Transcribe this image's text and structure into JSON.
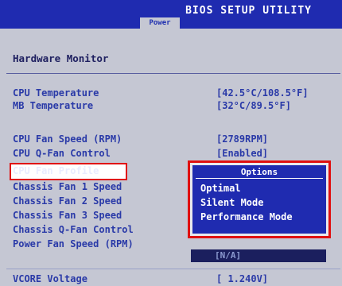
{
  "header": {
    "title": "BIOS SETUP UTILITY",
    "active_tab": "Power"
  },
  "section": {
    "title": "Hardware Monitor"
  },
  "items": [
    {
      "label": "CPU Temperature",
      "value": "[42.5°C/108.5°F]"
    },
    {
      "label": "MB Temperature",
      "value": "[32°C/89.5°F]"
    },
    {
      "label": "CPU Fan Speed (RPM)",
      "value": "[2789RPM]"
    },
    {
      "label": "CPU Q-Fan Control",
      "value": "[Enabled]"
    },
    {
      "label": "CPU Fan Profile",
      "value": ""
    },
    {
      "label": "Chassis Fan 1 Speed",
      "value": ""
    },
    {
      "label": "Chassis Fan 2 Speed",
      "value": ""
    },
    {
      "label": "Chassis Fan 3 Speed",
      "value": ""
    },
    {
      "label": "Chassis Q-Fan Control",
      "value": ""
    },
    {
      "label": "Power Fan Speed (RPM)",
      "value": "[N/A]"
    },
    {
      "label": "VCORE  Voltage",
      "value": "[ 1.240V]"
    }
  ],
  "options_popup": {
    "title": "Options",
    "options": [
      "Optimal",
      "Silent Mode",
      "Performance Mode"
    ],
    "selected": "Optimal"
  },
  "colors": {
    "bios_blue": "#1f2bb0",
    "panel_gray": "#c5c7d3",
    "highlight_red": "#e01010"
  }
}
